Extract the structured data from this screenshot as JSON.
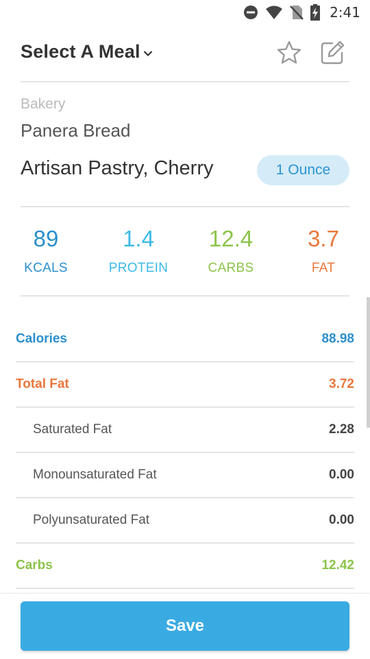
{
  "status_bar": {
    "time": "2:41"
  },
  "header": {
    "title": "Select A Meal"
  },
  "food": {
    "category": "Bakery",
    "brand": "Panera Bread",
    "name": "Artisan Pastry, Cherry",
    "serving": "1 Ounce"
  },
  "macros": [
    {
      "value": "89",
      "label": "KCALS",
      "color": "#2b8fcb"
    },
    {
      "value": "1.4",
      "label": "PROTEIN",
      "color": "#3cb9e6"
    },
    {
      "value": "12.4",
      "label": "CARBS",
      "color": "#8cc34b"
    },
    {
      "value": "3.7",
      "label": "FAT",
      "color": "#e8773a"
    }
  ],
  "nutrients": [
    {
      "label": "Calories",
      "value": "88.98",
      "color": "#2b8fcb"
    },
    {
      "label": "Total Fat",
      "value": "3.72",
      "color": "#e8773a"
    },
    {
      "label": "Saturated Fat",
      "value": "2.28",
      "color": "#555555"
    },
    {
      "label": "Monounsaturated Fat",
      "value": "0.00",
      "color": "#555555"
    },
    {
      "label": "Polyunsaturated Fat",
      "value": "0.00",
      "color": "#555555"
    },
    {
      "label": "Carbs",
      "value": "12.42",
      "color": "#8cc34b"
    }
  ],
  "save": {
    "label": "Save",
    "color": "#3aabe2"
  }
}
